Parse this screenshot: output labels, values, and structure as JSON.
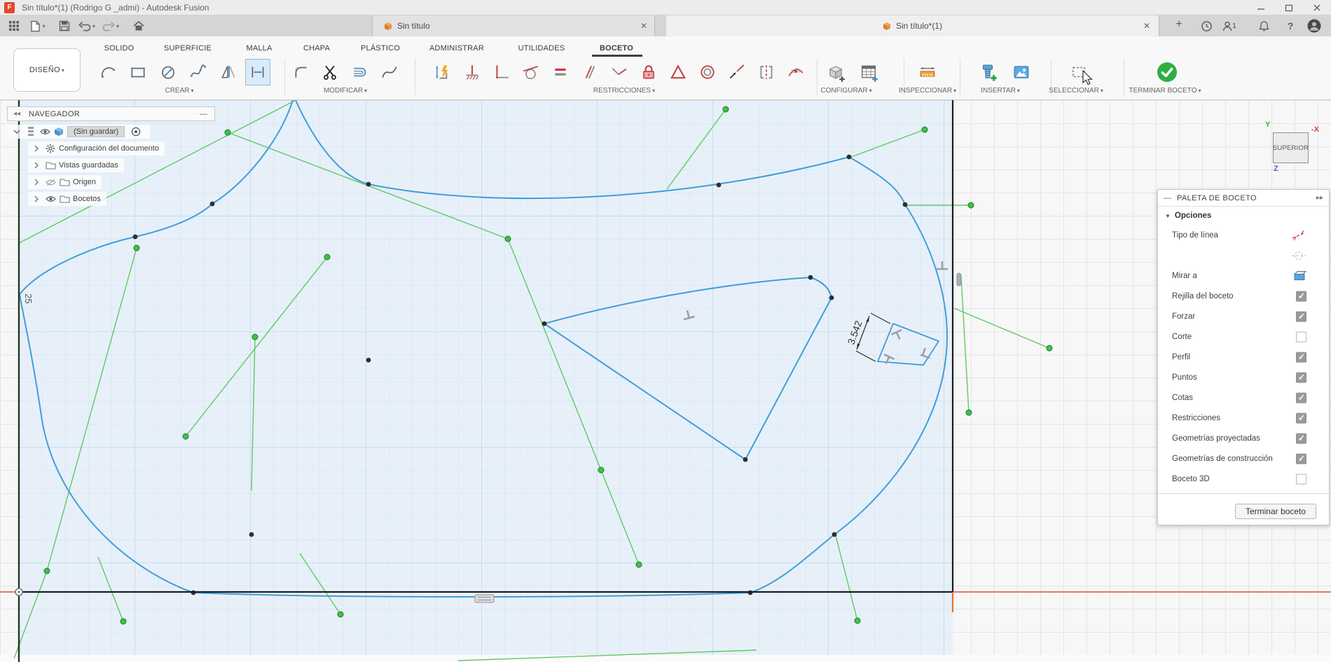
{
  "title_bar": {
    "title": "Sin título*(1) (Rodrigo G _admi) - Autodesk Fusion"
  },
  "app_bar": {
    "tabs": [
      {
        "label": "Sin título"
      },
      {
        "label": "Sin título*(1)"
      }
    ],
    "notification_count": "1",
    "help_glyph": "?"
  },
  "ribbon": {
    "design_selector": "DISEÑO",
    "tabs": [
      {
        "label": "SOLIDO"
      },
      {
        "label": "SUPERFICIE"
      },
      {
        "label": "MALLA"
      },
      {
        "label": "CHAPA"
      },
      {
        "label": "PLÁSTICO"
      },
      {
        "label": "ADMINISTRAR"
      },
      {
        "label": "UTILIDADES"
      },
      {
        "label": "BOCETO"
      }
    ],
    "active_tab": "BOCETO",
    "groups": [
      {
        "label": "CREAR"
      },
      {
        "label": "MODIFICAR"
      },
      {
        "label": "RESTRICCIONES"
      },
      {
        "label": "CONFIGURAR"
      },
      {
        "label": "INSPECCIONAR"
      },
      {
        "label": "INSERTAR"
      },
      {
        "label": "SELECCIONAR"
      },
      {
        "label": "TERMINAR BOCETO"
      }
    ]
  },
  "navigator": {
    "title": "NAVEGADOR",
    "root_item": "(Sin guardar)",
    "items": [
      {
        "label": "Configuración del documento"
      },
      {
        "label": "Vistas guardadas"
      },
      {
        "label": "Origen",
        "visible": false
      },
      {
        "label": "Bocetos",
        "visible": true
      }
    ]
  },
  "sketch_palette": {
    "title": "PALETA DE BOCETO",
    "section": "Opciones",
    "options": [
      {
        "label": "Tipo de línea",
        "control": "icons"
      },
      {
        "label": "",
        "control": "icon"
      },
      {
        "label": "Mirar a",
        "control": "icon"
      },
      {
        "label": "Rejilla del boceto",
        "control": "checkbox",
        "checked": true
      },
      {
        "label": "Forzar",
        "control": "checkbox",
        "checked": true
      },
      {
        "label": "Corte",
        "control": "checkbox",
        "checked": false
      },
      {
        "label": "Perfil",
        "control": "checkbox",
        "checked": true
      },
      {
        "label": "Puntos",
        "control": "checkbox",
        "checked": true
      },
      {
        "label": "Cotas",
        "control": "checkbox",
        "checked": true
      },
      {
        "label": "Restricciones",
        "control": "checkbox",
        "checked": true
      },
      {
        "label": "Geometrías proyectadas",
        "control": "checkbox",
        "checked": true
      },
      {
        "label": "Geometrías de construcción",
        "control": "checkbox",
        "checked": true
      },
      {
        "label": "Boceto 3D",
        "control": "checkbox",
        "checked": false
      }
    ],
    "finish_button": "Terminar boceto"
  },
  "canvas": {
    "dimension_label": "3.542",
    "grid_ruler_label": "25",
    "viewcube": {
      "face": "SUPERIOR",
      "axis_y": "Y",
      "axis_x": "-X",
      "axis_z": "Z"
    }
  },
  "colors": {
    "sketch_line": "#3f9ed9",
    "construction_green": "#58c75b",
    "axis_red": "#e04b3c",
    "selected_tool_bg": "#d9ebf9",
    "finish_green": "#2fae44",
    "fusion_orange": "#e8872c"
  }
}
